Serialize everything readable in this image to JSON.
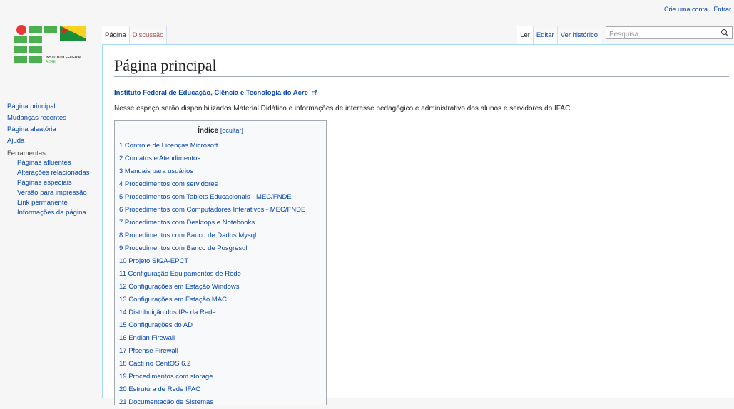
{
  "personal": {
    "create_account": "Crie uma conta",
    "login": "Entrar"
  },
  "logo": {
    "name": "INSTITUTO FEDERAL",
    "sub": "ACRE"
  },
  "sidebar": {
    "nav": [
      "Página principal",
      "Mudanças recentes",
      "Página aleatória",
      "Ajuda"
    ],
    "tools_heading": "Ferramentas",
    "tools": [
      "Páginas afluentes",
      "Alterações relacionadas",
      "Páginas especiais",
      "Versão para impressão",
      "Link permanente",
      "Informações da página"
    ]
  },
  "tabs": {
    "page": "Página",
    "discussion": "Discussão",
    "read": "Ler",
    "edit": "Editar",
    "history": "Ver histórico"
  },
  "search": {
    "placeholder": "Pesquisa",
    "icon": "search-icon"
  },
  "content": {
    "title": "Página principal",
    "subtitle_link": "Instituto Federal de Educação, Ciência e Tecnologia do Acre",
    "intro": "Nesse espaço serão disponibilizados Material Didático e informações de interesse pedagógico e administrativo dos alunos e servidores do IFAC."
  },
  "toc": {
    "title": "Índice",
    "toggle": "[ocultar]",
    "items": [
      "1 Controle de Licenças Microsoft",
      "2 Contatos e Atendimentos",
      "3 Manuais para usuários",
      "4 Procedimentos com servidores",
      "5 Procedimentos com Tablets Educacionais - MEC/FNDE",
      "6 Procedimentos com Computadores Interativos - MEC/FNDE",
      "7 Procedimentos com Desktops e Notebooks",
      "8 Procedimentos com Banco de Dados Mysql",
      "9 Procedimentos com Banco de Posgresql",
      "10 Projeto SIGA-EPCT",
      "11 Configuração Equipamentos de Rede",
      "12 Configurações em Estação Windows",
      "13 Configurações em Estação MAC",
      "14 Distribuição dos IPs da Rede",
      "15 Configurações do AD",
      "16 Endian Firewall",
      "17 Pfsense Firewall",
      "18 Cacti no CentOS 6.2",
      "19 Procedimentos com storage",
      "20 Estrutura de Rede IFAC",
      "21 Documentação de Sistemas"
    ]
  },
  "colors": {
    "link": "#0645ad",
    "logo_green": "#4caf50",
    "logo_red": "#e53935",
    "border_blue": "#a7d7f9"
  }
}
